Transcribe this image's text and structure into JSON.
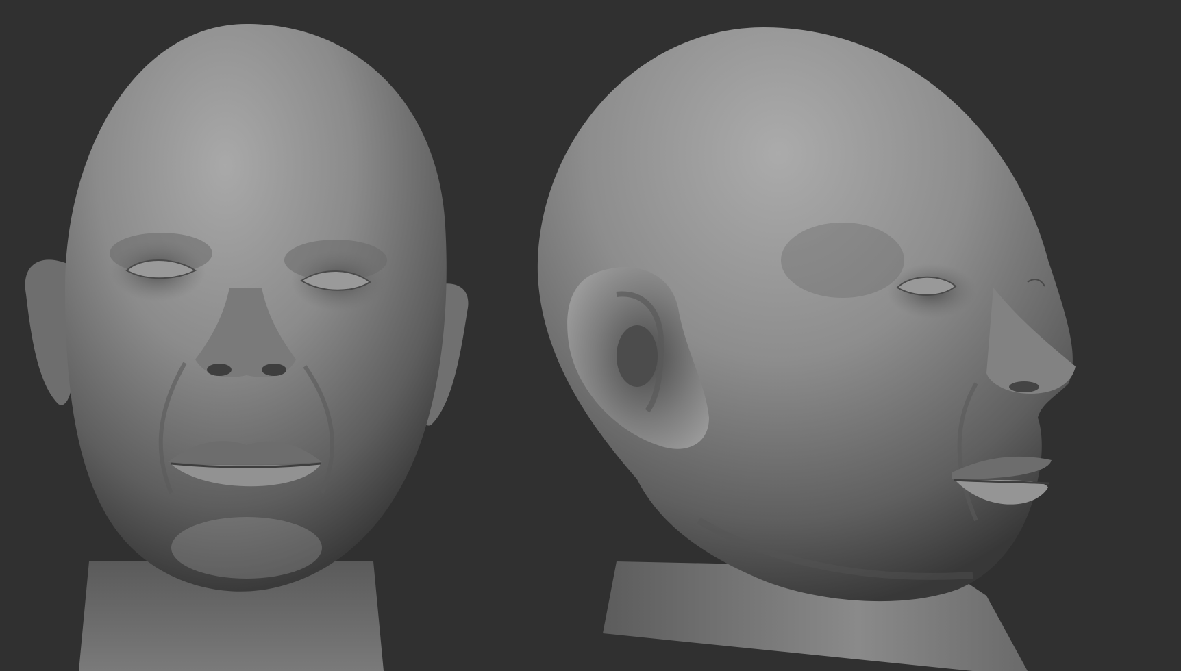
{
  "scene": {
    "background_color": "#303030",
    "clay_color": "#8a8a8a",
    "views": [
      {
        "id": "front",
        "subject": "sculpted-head"
      },
      {
        "id": "three-quarter",
        "subject": "sculpted-head"
      }
    ]
  }
}
